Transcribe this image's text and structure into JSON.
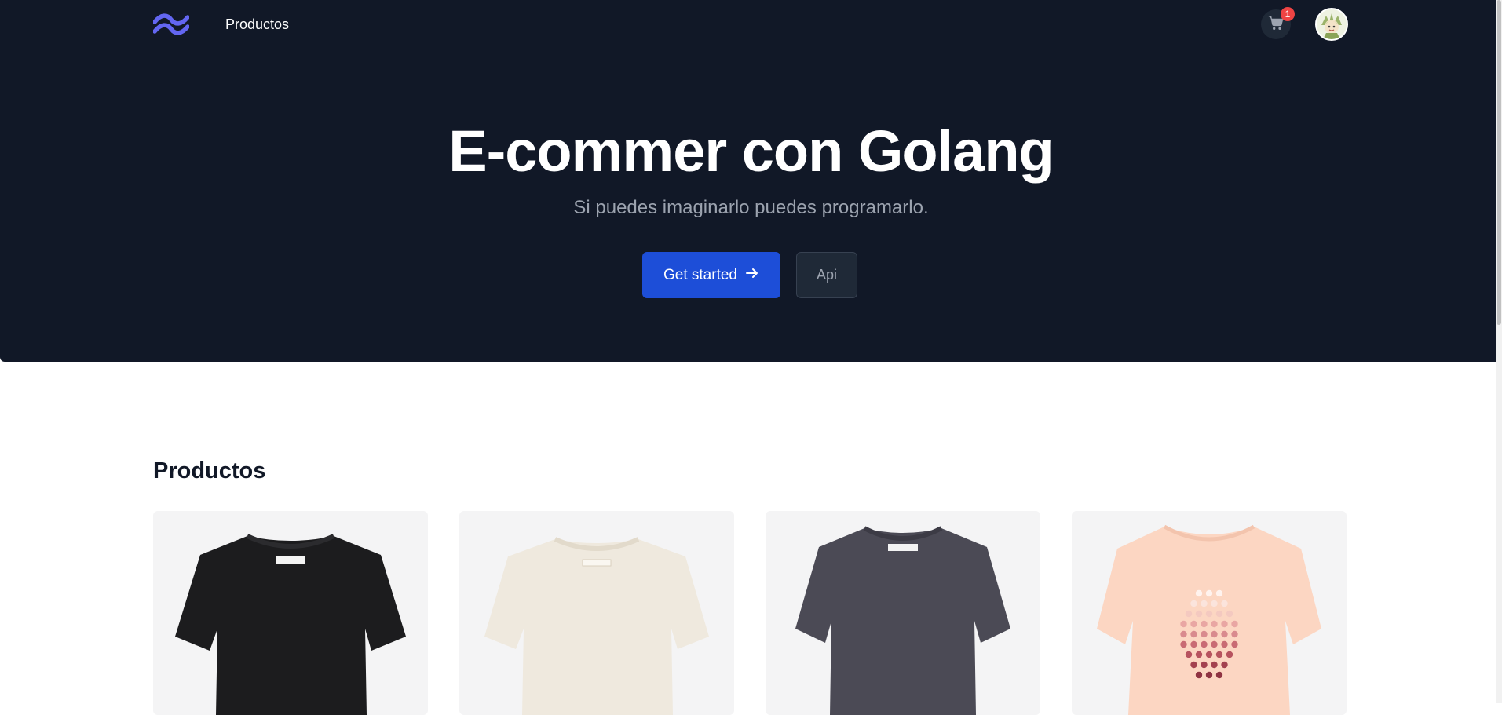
{
  "nav": {
    "logo_icon": "tailwind-wave-logo",
    "link_label": "Productos",
    "cart_icon": "shopping-cart-icon",
    "cart_count": "1",
    "avatar_icon": "user-avatar"
  },
  "hero": {
    "title": "E-commer con Golang",
    "subtitle": "Si puedes imaginarlo puedes programarlo.",
    "primary_button": "Get started",
    "primary_button_icon": "arrow-right-icon",
    "secondary_button": "Api"
  },
  "products": {
    "title": "Productos",
    "items": [
      {
        "image": "tshirt-black",
        "color": "#1c1c1e"
      },
      {
        "image": "tshirt-white",
        "color": "#efe9de"
      },
      {
        "image": "tshirt-charcoal",
        "color": "#4b4a55"
      },
      {
        "image": "tshirt-peach-dots",
        "color": "#fcd6c2"
      }
    ]
  },
  "colors": {
    "hero_bg": "#111827",
    "primary": "#1d4ed8",
    "badge": "#ef4444",
    "logo": "#6366f1"
  }
}
